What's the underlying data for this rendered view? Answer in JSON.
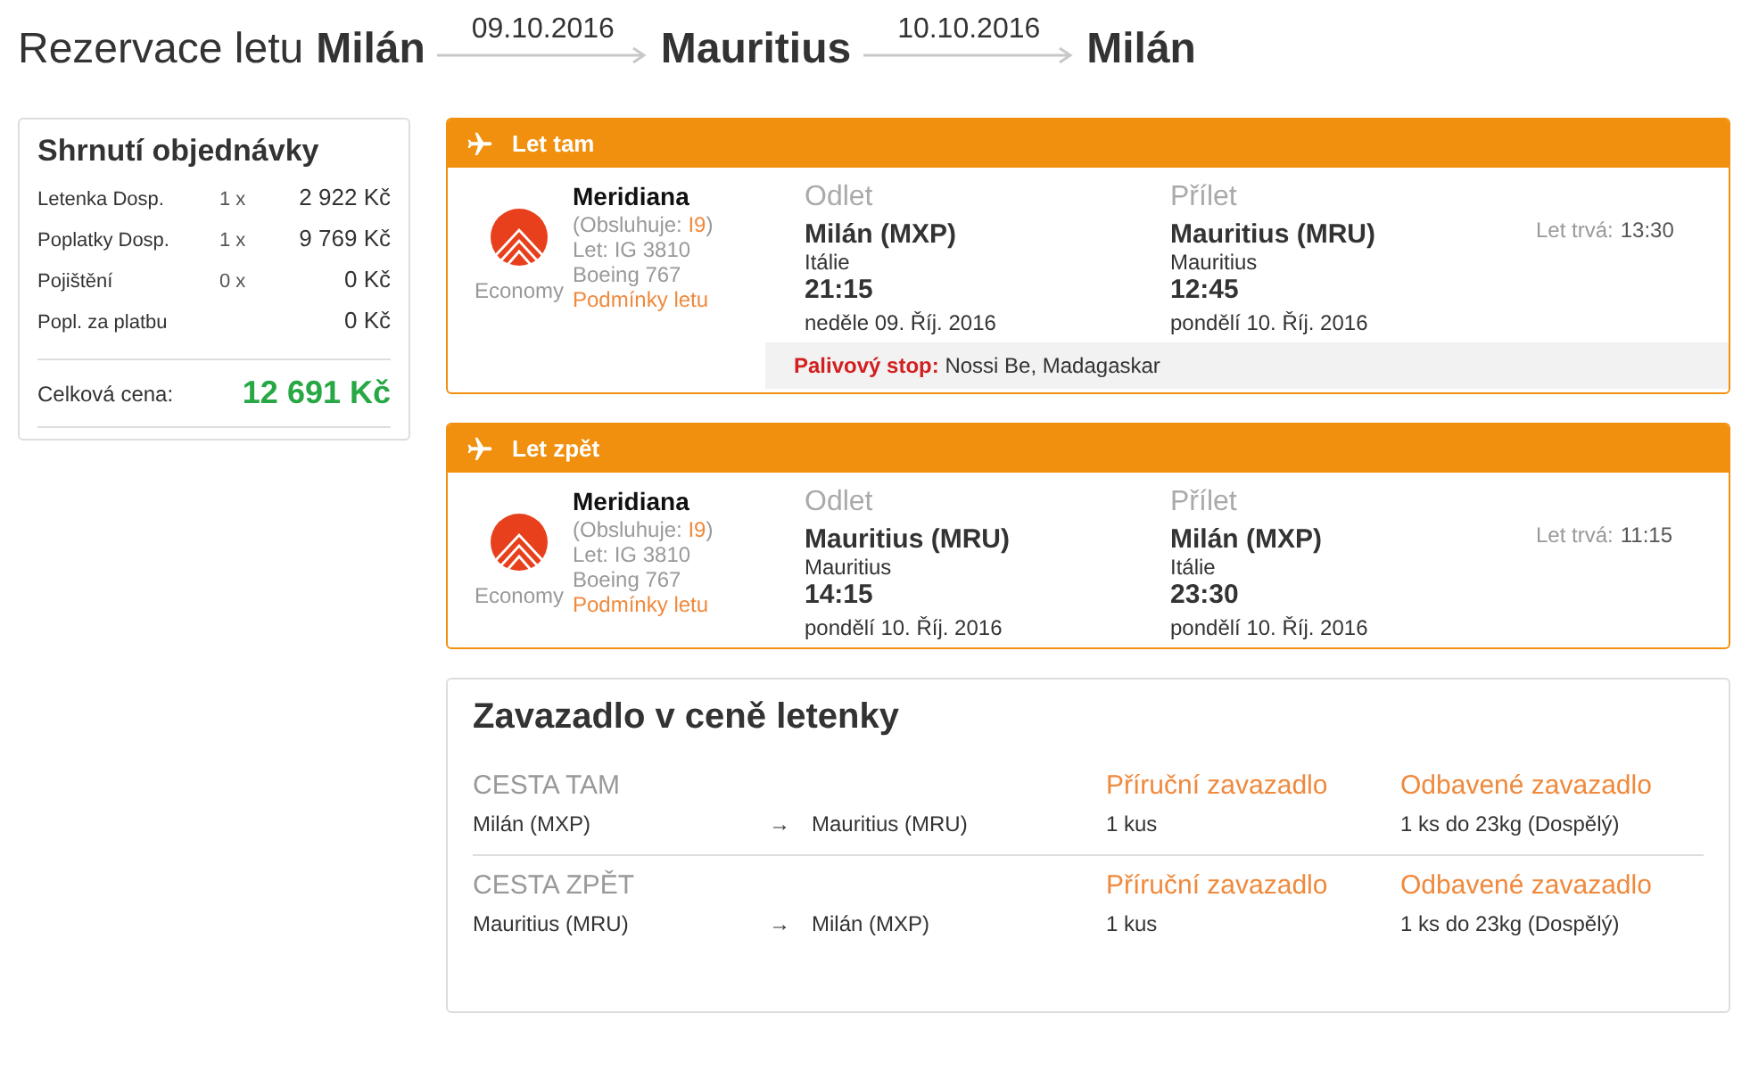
{
  "header": {
    "title": "Rezervace letu",
    "origin": "Milán",
    "legs": [
      {
        "date": "09.10.2016",
        "city": "Mauritius"
      },
      {
        "date": "10.10.2016",
        "city": "Milán"
      }
    ]
  },
  "summary": {
    "title": "Shrnutí objednávky",
    "rows": [
      {
        "label": "Letenka Dosp.",
        "qty": "1 x",
        "price": "2 922 Kč"
      },
      {
        "label": "Poplatky Dosp.",
        "qty": "1 x",
        "price": "9 769 Kč"
      },
      {
        "label": "Pojištění",
        "qty": "0 x",
        "price": "0 Kč"
      },
      {
        "label": "Popl. za platbu",
        "price": "0 Kč"
      }
    ],
    "total_label": "Celková cena:",
    "total": "12 691 Kč"
  },
  "flights": [
    {
      "title": "Let tam",
      "airline": "Meridiana",
      "operated_by": {
        "prefix": "(Obsluhuje: ",
        "code": "I9",
        "suffix": ")"
      },
      "flight": "Let: IG 3810",
      "aircraft": "Boeing 767",
      "class": "Economy",
      "conditions": "Podmínky letu",
      "departure": {
        "heading": "Odlet",
        "airport": "Milán (MXP)",
        "country": "Itálie",
        "time": "21:15",
        "date": "neděle 09. Říj. 2016"
      },
      "arrival": {
        "heading": "Přílet",
        "airport": "Mauritius (MRU)",
        "country": "Mauritius",
        "time": "12:45",
        "date": "pondělí 10. Říj. 2016"
      },
      "duration_label": "Let trvá:",
      "duration": "13:30",
      "fuel_stop": {
        "label": "Palivový stop:",
        "value": "Nossi Be, Madagaskar"
      }
    },
    {
      "title": "Let zpět",
      "airline": "Meridiana",
      "operated_by": {
        "prefix": "(Obsluhuje: ",
        "code": "I9",
        "suffix": ")"
      },
      "flight": "Let: IG 3810",
      "aircraft": "Boeing 767",
      "class": "Economy",
      "conditions": "Podmínky letu",
      "departure": {
        "heading": "Odlet",
        "airport": "Mauritius (MRU)",
        "country": "Mauritius",
        "time": "14:15",
        "date": "pondělí 10. Říj. 2016"
      },
      "arrival": {
        "heading": "Přílet",
        "airport": "Milán (MXP)",
        "country": "Itálie",
        "time": "23:30",
        "date": "pondělí 10. Říj. 2016"
      },
      "duration_label": "Let trvá:",
      "duration": "11:15"
    }
  ],
  "baggage": {
    "title": "Zavazadlo v ceně letenky",
    "sections": [
      {
        "heading": "CESTA TAM",
        "from": "Milán (MXP)",
        "arrow": "→",
        "to": "Mauritius (MRU)",
        "cabin_heading": "Příruční zavazadlo",
        "cabin": "1 kus",
        "checked_heading": "Odbavené zavazadlo",
        "checked": "1 ks do 23kg (Dospělý)"
      },
      {
        "heading": "CESTA ZPĚT",
        "from": "Mauritius (MRU)",
        "arrow": "→",
        "to": "Milán (MXP)",
        "cabin_heading": "Příruční zavazadlo",
        "cabin": "1 kus",
        "checked_heading": "Odbavené zavazadlo",
        "checked": "1 ks do 23kg (Dospělý)"
      }
    ]
  }
}
